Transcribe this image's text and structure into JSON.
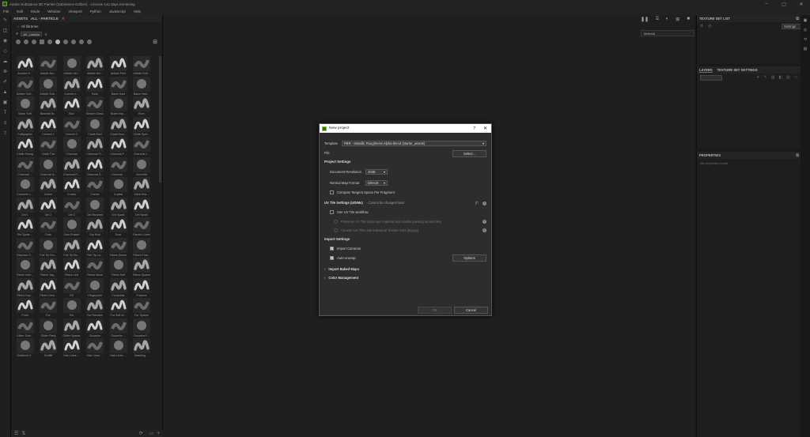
{
  "window": {
    "title": "Adobe Substance 3D Painter (Substance Edition) - License 142 days remaining"
  },
  "menu": [
    "File",
    "Edit",
    "Mode",
    "Window",
    "Viewport",
    "Python",
    "JavaScript",
    "Help"
  ],
  "assets": {
    "tab_label": "ASSETS",
    "filter_label": "ALL - PARTICLE",
    "library": "All libraries",
    "search_chip": "All - particle",
    "items": [
      "Archive H...",
      "Artistic Bru...",
      "Artistic Hei...",
      "Artistic Hei...",
      "Artistic Print",
      "Artistic Soft...",
      "Artistic Soft...",
      "Artistic Soft...",
      "Autumn L...",
      "Bark",
      "Basic Hard",
      "Basic Hard...",
      "Basic Soft",
      "Basmati Br...",
      "Blur",
      "Broken Glass",
      "Bullet Imp...",
      "Burn",
      "Calligraphic",
      "Cement 1",
      "Cement 2",
      "Chalk Bold",
      "Chalk Bum...",
      "Chalk Spre...",
      "Chalk Strong",
      "Chalk Thin",
      "Charcoal",
      "Charcoal Fi...",
      "Charcoal F...",
      "Charcoal L...",
      "Charcoal ...",
      "Charcoal N...",
      "Charcoal R...",
      "Charcoal S...",
      "Charcoal ...",
      "Concrete",
      "Concrete L...",
      "Cotton",
      "Cracks",
      "Cracks",
      "Crystal",
      "Dark Hea...",
      "Dirt 1",
      "Dirt 2",
      "Dirt 3",
      "Dirt Brushed",
      "Dirt Spark",
      "Dirt Spots",
      "Dirt Spots ...",
      "Dots",
      "Dots Erased",
      "Dry Mud",
      "Dust",
      "Electric Lines",
      "Elephant S...",
      "Felt Tip Em...",
      "Felt Tip Bo...",
      "Felt Tip La...",
      "Fibers Dense",
      "Fibers Feat...",
      "Fibers Inter...",
      "Fibers Jag...",
      "Fibers Line",
      "Fibers Moss",
      "Fibers Soft",
      "Fibers Sparse",
      "Fibers Squ...",
      "Fibers Verti...",
      "Fill",
      "Fingerprint",
      "Footprints",
      "Fracture",
      "Frost",
      "Fur",
      "Fur",
      "Fur Random",
      "Fur Soft W...",
      "Fur Sparse",
      "Glitter Dots...",
      "Glitter Party",
      "Glitter Sparse",
      "Gouache",
      "Gouache ...",
      "Gouache F...",
      "Gradient H...",
      "Graffiti",
      "Hair Lines ...",
      "Hair Lines ...",
      "Hair Lines ...",
      "Hatching ..."
    ]
  },
  "viewport": {
    "material_select": "Material"
  },
  "texture_set_list": {
    "title": "TEXTURE SET LIST",
    "settings": "Settings"
  },
  "layers": {
    "tab1": "LAYERS",
    "tab2": "TEXTURE SET SETTINGS"
  },
  "properties": {
    "title": "PROPERTIES",
    "empty": "No properties found"
  },
  "dialog": {
    "title": "New project",
    "help": "?",
    "template_label": "Template",
    "template_value": "PBR - Metallic Roughness Alpha-blend (starter_assets)",
    "file_label": "File",
    "select_button": "Select...",
    "project_settings": "Project Settings",
    "doc_res_label": "Document Resolution",
    "doc_res_value": "2048",
    "normal_fmt_label": "Normal Map Format",
    "normal_fmt_value": "DirectX",
    "tangent_label": "Compute Tangent Space Per Fragment",
    "uv_section": "UV Tile Settings (UDIMs)",
    "uv_note": "- Cannot be changed later",
    "uv_workflow": "Use UV Tile workflow",
    "uv_opt1": "Preserve UV Tile layout per material and enable painting across tiles",
    "uv_opt2": "Convert UV Tiles into individual Texture Sets (legacy)",
    "import_settings": "Import Settings",
    "import_cameras": "Import Cameras",
    "auto_unwrap": "Auto-unwrap",
    "options_button": "Options",
    "import_baked": "Import Baked Maps",
    "color_mgmt": "Color Management",
    "ok_button": "OK",
    "cancel_button": "Cancel"
  }
}
